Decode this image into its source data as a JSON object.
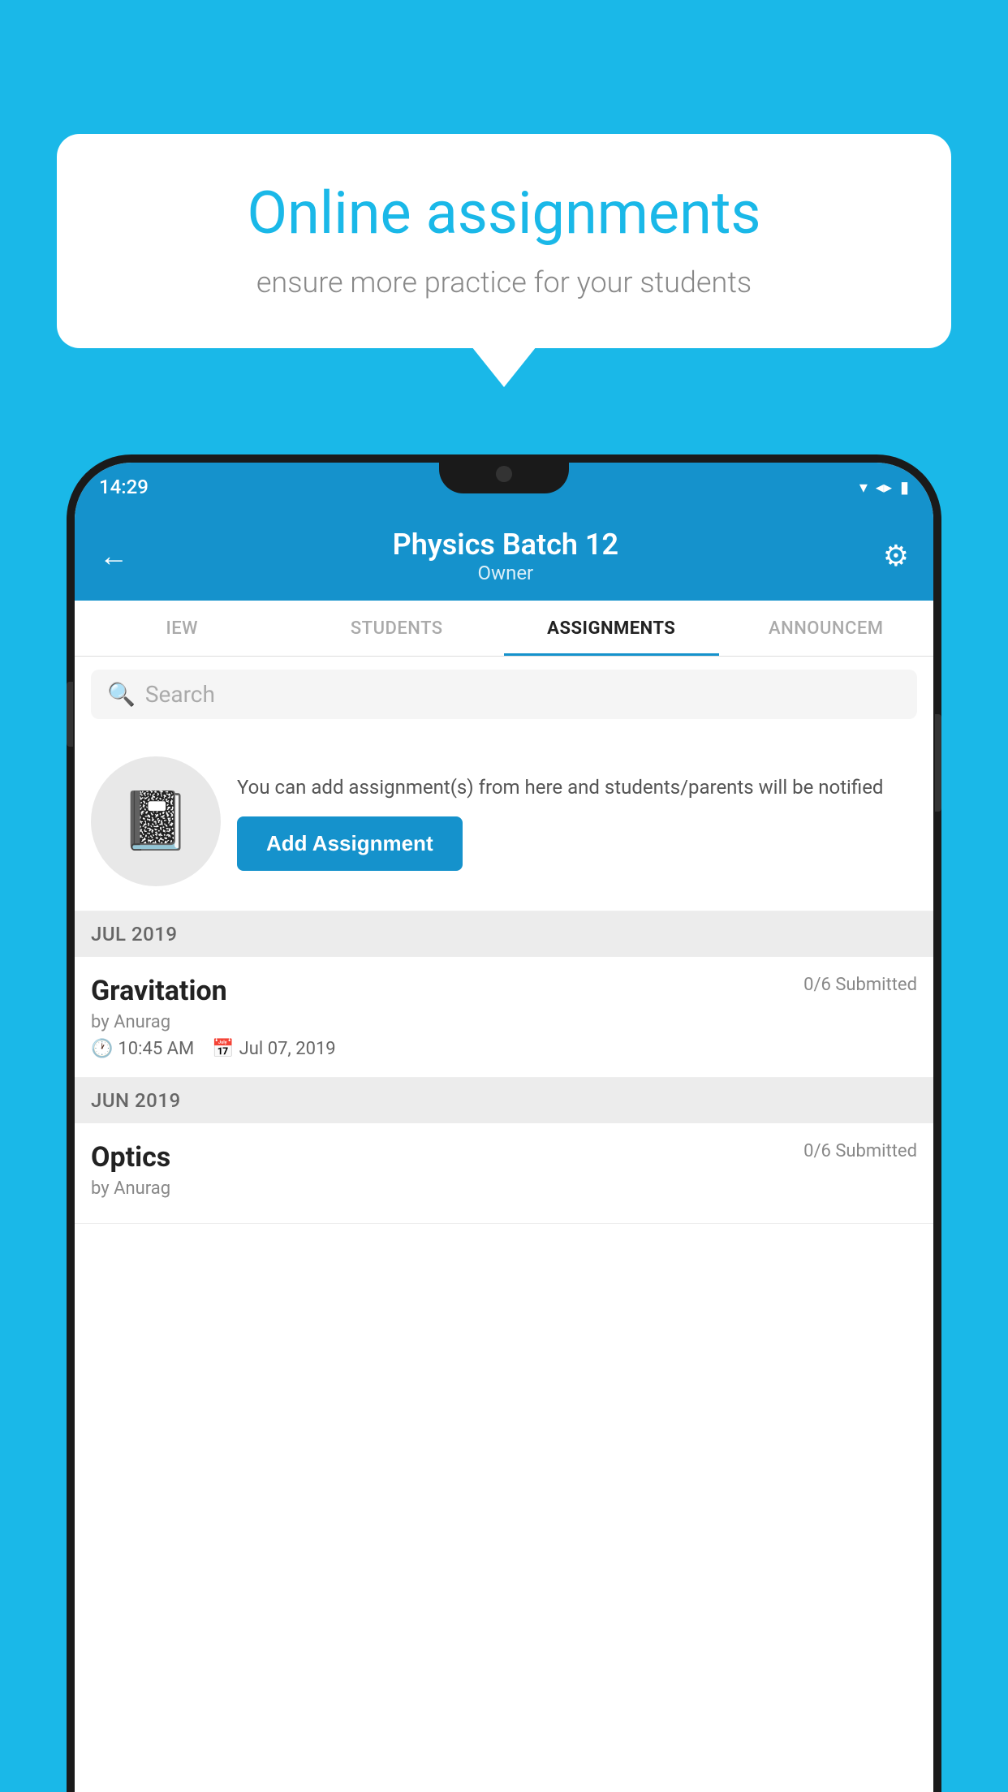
{
  "background_color": "#1ab8e8",
  "speech_bubble": {
    "title": "Online assignments",
    "subtitle": "ensure more practice for your students"
  },
  "status_bar": {
    "time": "14:29",
    "icons": [
      "▼",
      "◀",
      "▮"
    ]
  },
  "header": {
    "title": "Physics Batch 12",
    "subtitle": "Owner",
    "back_label": "←",
    "settings_label": "⚙"
  },
  "tabs": [
    {
      "label": "IEW",
      "active": false
    },
    {
      "label": "STUDENTS",
      "active": false
    },
    {
      "label": "ASSIGNMENTS",
      "active": true
    },
    {
      "label": "ANNOUNCEM",
      "active": false
    }
  ],
  "search": {
    "placeholder": "Search"
  },
  "promo": {
    "text": "You can add assignment(s) from here and students/parents will be notified",
    "button_label": "Add Assignment"
  },
  "assignments": [
    {
      "month_header": "JUL 2019",
      "name": "Gravitation",
      "submitted": "0/6 Submitted",
      "author": "by Anurag",
      "time": "10:45 AM",
      "date": "Jul 07, 2019"
    },
    {
      "month_header": "JUN 2019",
      "name": "Optics",
      "submitted": "0/6 Submitted",
      "author": "by Anurag",
      "time": "",
      "date": ""
    }
  ]
}
